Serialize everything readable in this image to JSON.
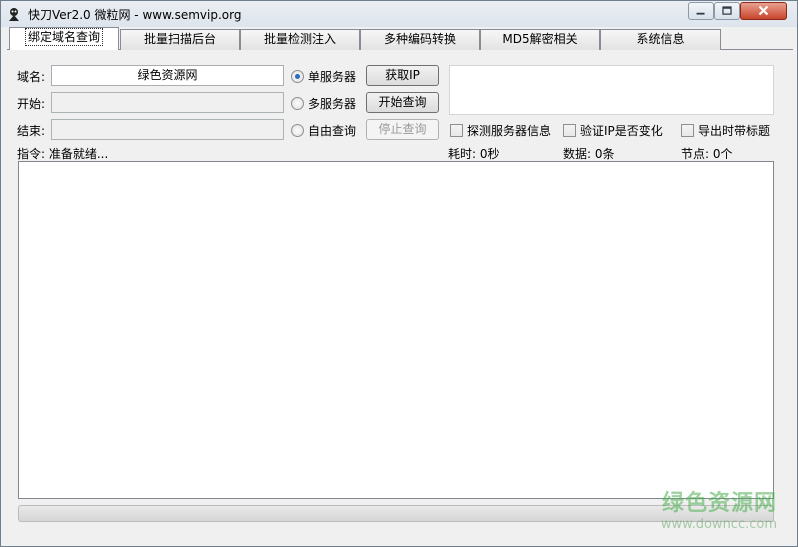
{
  "window": {
    "title": "快刀Ver2.0   微粒网 - www.semvip.org"
  },
  "tabs": [
    {
      "label": "绑定域名查询",
      "active": true
    },
    {
      "label": "批量扫描后台",
      "active": false
    },
    {
      "label": "批量检测注入",
      "active": false
    },
    {
      "label": "多种编码转换",
      "active": false
    },
    {
      "label": "MD5解密相关",
      "active": false
    },
    {
      "label": "系统信息",
      "active": false
    }
  ],
  "form": {
    "domain_label": "域名:",
    "domain_value": "绿色资源网",
    "start_label": "开始:",
    "start_value": "",
    "end_label": "结束:",
    "end_value": ""
  },
  "mode": {
    "single_server": "单服务器",
    "multi_server": "多服务器",
    "free_query": "自由查询",
    "selected": "单服务器"
  },
  "buttons": {
    "get_ip": "获取IP",
    "start_query": "开始查询",
    "stop_query": "停止查询"
  },
  "options": {
    "detect_server_info": "探测服务器信息",
    "verify_ip_change": "验证IP是否变化",
    "export_with_title": "导出时带标题"
  },
  "status": {
    "command": "指令: 准备就绪...",
    "elapsed": "耗时: 0秒",
    "data_count": "数据: 0条",
    "nodes": "节点: 0个"
  },
  "watermark": {
    "text": "绿色资源网",
    "url": "www.downcc.com"
  },
  "colors": {
    "accent": "#2b6dbf",
    "close_button": "#c8442c",
    "watermark": "#4caf50"
  }
}
